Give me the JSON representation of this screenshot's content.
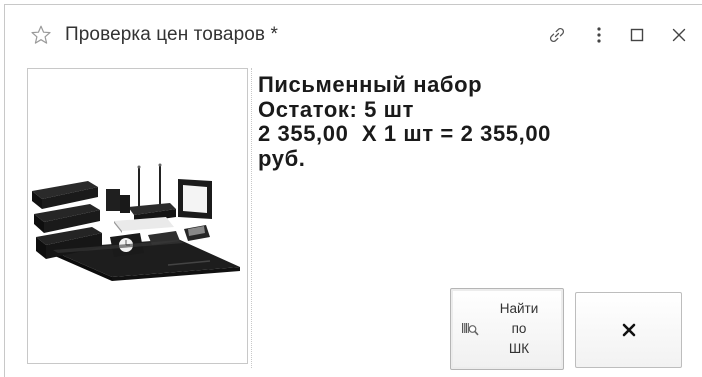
{
  "window": {
    "title": "Проверка цен товаров *",
    "star_icon": "star-outline-icon",
    "link_icon": "link-icon",
    "more_icon": "more-vertical-icon",
    "maximize_icon": "maximize-icon",
    "close_icon": "close-icon"
  },
  "product": {
    "name": "Письменный набор",
    "stock_line": "Остаток: 5 шт",
    "price_line": "2 355,00  Х 1 шт = 2 355,00",
    "currency_line": "руб."
  },
  "buttons": {
    "find_by_barcode_label": "Найти\nпо\nШК",
    "find_icon": "barcode-scan-icon",
    "close_icon": "close-x-icon"
  },
  "colors": {
    "border": "#c8c8c8",
    "text": "#1a1a1a",
    "title_text": "#333333"
  }
}
